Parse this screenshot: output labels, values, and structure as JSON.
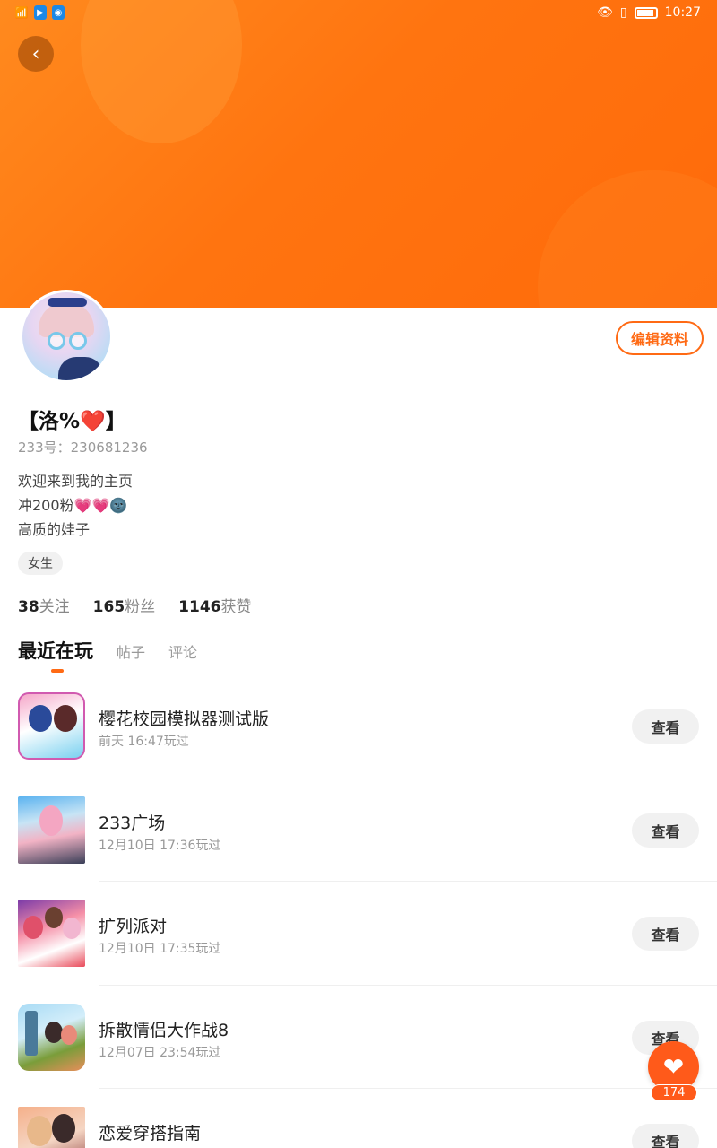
{
  "status_bar": {
    "time": "10:27",
    "icons": [
      "wifi-icon",
      "notification-app-icon",
      "notification-app-icon",
      "eye-icon",
      "vibrate-icon",
      "battery-icon"
    ]
  },
  "header": {
    "back_icon": "chevron-left-icon",
    "edit_profile_label": "编辑资料"
  },
  "profile": {
    "username": "【洛%",
    "username_heart": "❤️",
    "username_close": "】",
    "account_label": "233号：",
    "account_id": "230681236",
    "bio_lines": [
      "欢迎来到我的主页",
      "冲200粉",
      "高质的娃子"
    ],
    "bio_emojis": "💗💗🌚",
    "gender_tag": "女生"
  },
  "stats": [
    {
      "value": "38",
      "label": "关注"
    },
    {
      "value": "165",
      "label": "粉丝"
    },
    {
      "value": "1146",
      "label": "获赞"
    }
  ],
  "tabs": [
    {
      "label": "最近在玩",
      "active": true
    },
    {
      "label": "帖子",
      "active": false
    },
    {
      "label": "评论",
      "active": false
    }
  ],
  "games": [
    {
      "name": "樱花校园模拟器测试版",
      "time": "前天 16:47玩过",
      "button": "查看"
    },
    {
      "name": "233广场",
      "time": "12月10日 17:36玩过",
      "button": "查看"
    },
    {
      "name": "扩列派对",
      "time": "12月10日 17:35玩过",
      "button": "查看"
    },
    {
      "name": "拆散情侣大作战8",
      "time": "12月07日 23:54玩过",
      "button": "查看"
    },
    {
      "name": "恋爱穿搭指南",
      "time": "",
      "button": "查看"
    }
  ],
  "fab": {
    "icon": "heart-icon",
    "count": "174"
  },
  "colors": {
    "accent": "#ff6a14",
    "header_gradient_start": "#ff8a1e",
    "header_gradient_end": "#ff6a0a"
  }
}
